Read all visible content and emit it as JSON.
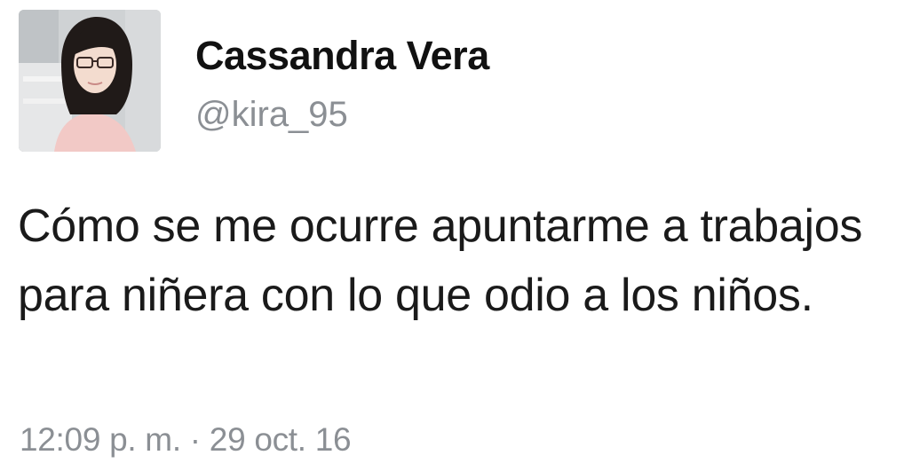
{
  "tweet": {
    "author": {
      "display_name": "Cassandra Vera",
      "handle": "@kira_95"
    },
    "text": "Cómo se me ocurre apuntarme a trabajos para niñera con lo que odio a los niños.",
    "timestamp": "12:09 p. m. · 29 oct. 16"
  },
  "colors": {
    "name": "#111111",
    "handle": "#8b8f94",
    "body_text": "#1a1a1a",
    "timestamp": "#8b8f94",
    "background": "#ffffff"
  }
}
